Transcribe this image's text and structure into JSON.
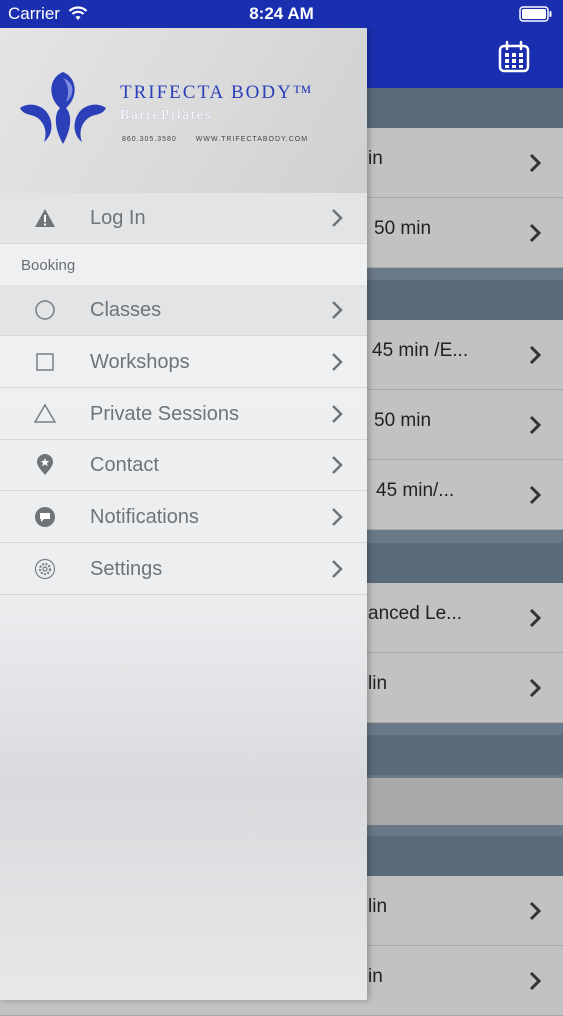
{
  "status_bar": {
    "carrier": "Carrier",
    "time": "8:24 AM"
  },
  "background_list": {
    "rows": [
      {
        "text": "in"
      },
      {
        "text": "50 min"
      },
      {
        "text": "45 min /E..."
      },
      {
        "text": "50 min"
      },
      {
        "text": "45 min/..."
      },
      {
        "text": "anced Le..."
      },
      {
        "text": "lin"
      },
      {
        "text": "lin"
      },
      {
        "text": "in"
      }
    ]
  },
  "drawer": {
    "logo": {
      "title": "TRIFECTA BODY™",
      "subtitle": "BarrePilates",
      "phone": "860.305.3580",
      "website": "WWW.TRIFECTABODY.COM"
    },
    "login": {
      "label": "Log In",
      "icon": "warning-icon"
    },
    "section_label": "Booking",
    "items": [
      {
        "label": "Classes",
        "icon": "circle-icon"
      },
      {
        "label": "Workshops",
        "icon": "square-icon"
      },
      {
        "label": "Private Sessions",
        "icon": "triangle-icon"
      },
      {
        "label": "Contact",
        "icon": "location-pin-icon"
      },
      {
        "label": "Notifications",
        "icon": "chat-bubble-icon"
      },
      {
        "label": "Settings",
        "icon": "gear-icon"
      }
    ]
  },
  "colors": {
    "brand_blue": "#1a2fb0",
    "logo_blue": "#2a3fb8",
    "menu_text": "#6f7478",
    "section_header": "#5a6b7a"
  }
}
